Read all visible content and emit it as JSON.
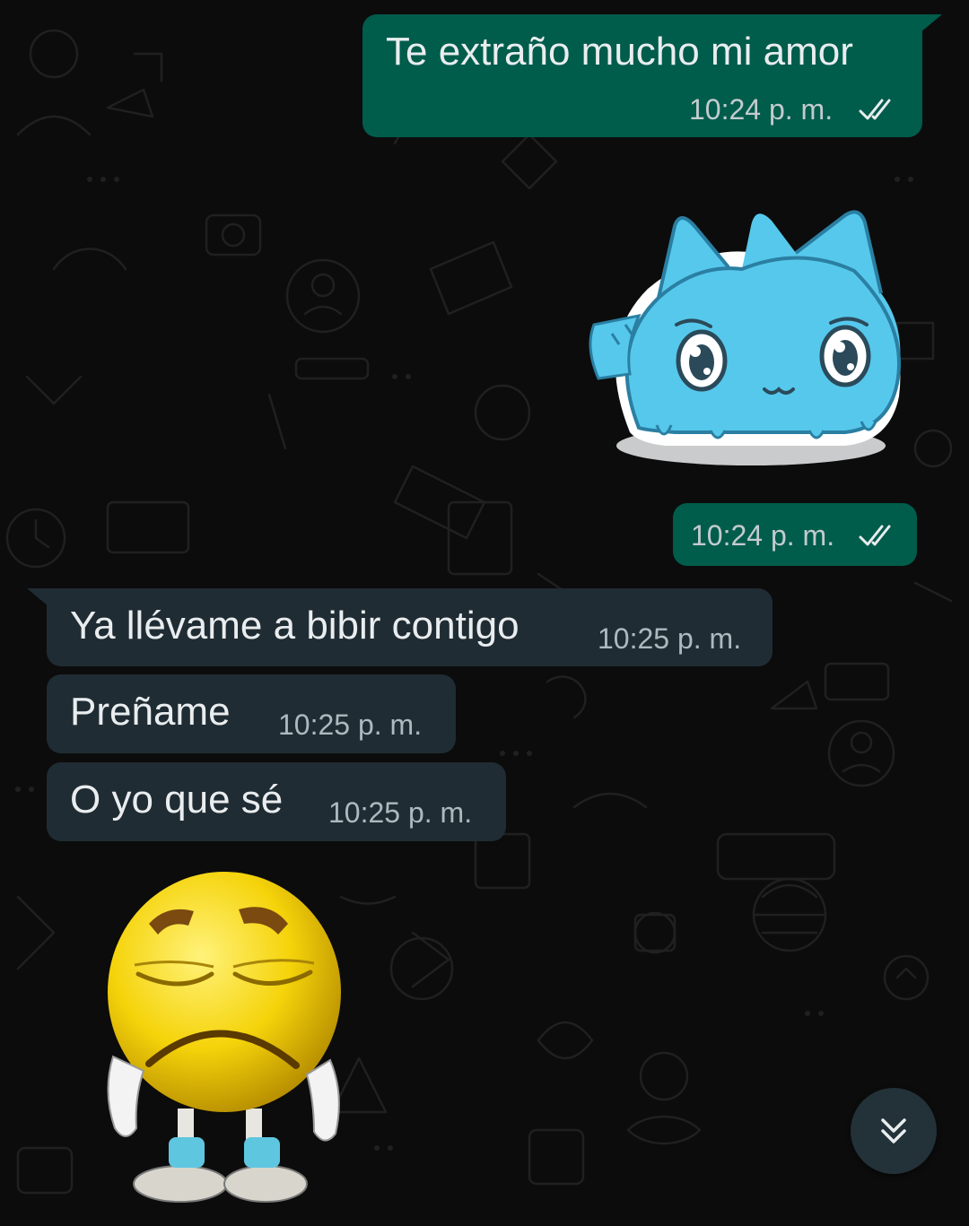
{
  "messages": [
    {
      "direction": "outgoing",
      "text": "Te extraño mucho mi amor",
      "time": "10:24 p. m.",
      "status": "read"
    },
    {
      "direction": "outgoing",
      "type": "sticker",
      "sticker": "sad-blue-cat-sticker",
      "time": "10:24 p. m.",
      "status": "read"
    },
    {
      "direction": "incoming",
      "text": "Ya llévame a bibir contigo",
      "time": "10:25 p. m."
    },
    {
      "direction": "incoming",
      "text": "Preñame",
      "time": "10:25 p. m."
    },
    {
      "direction": "incoming",
      "text": "O yo que sé",
      "time": "10:25 p. m."
    },
    {
      "direction": "incoming",
      "type": "sticker",
      "sticker": "sad-yellow-emoji-sticker"
    }
  ],
  "scroll_button": {
    "icon": "double-chevron-down-icon"
  },
  "colors": {
    "outgoing_bubble": "#005c4b",
    "incoming_bubble": "#202c33",
    "read_ticks": "#53bdeb",
    "background": "#0c0c0c"
  }
}
